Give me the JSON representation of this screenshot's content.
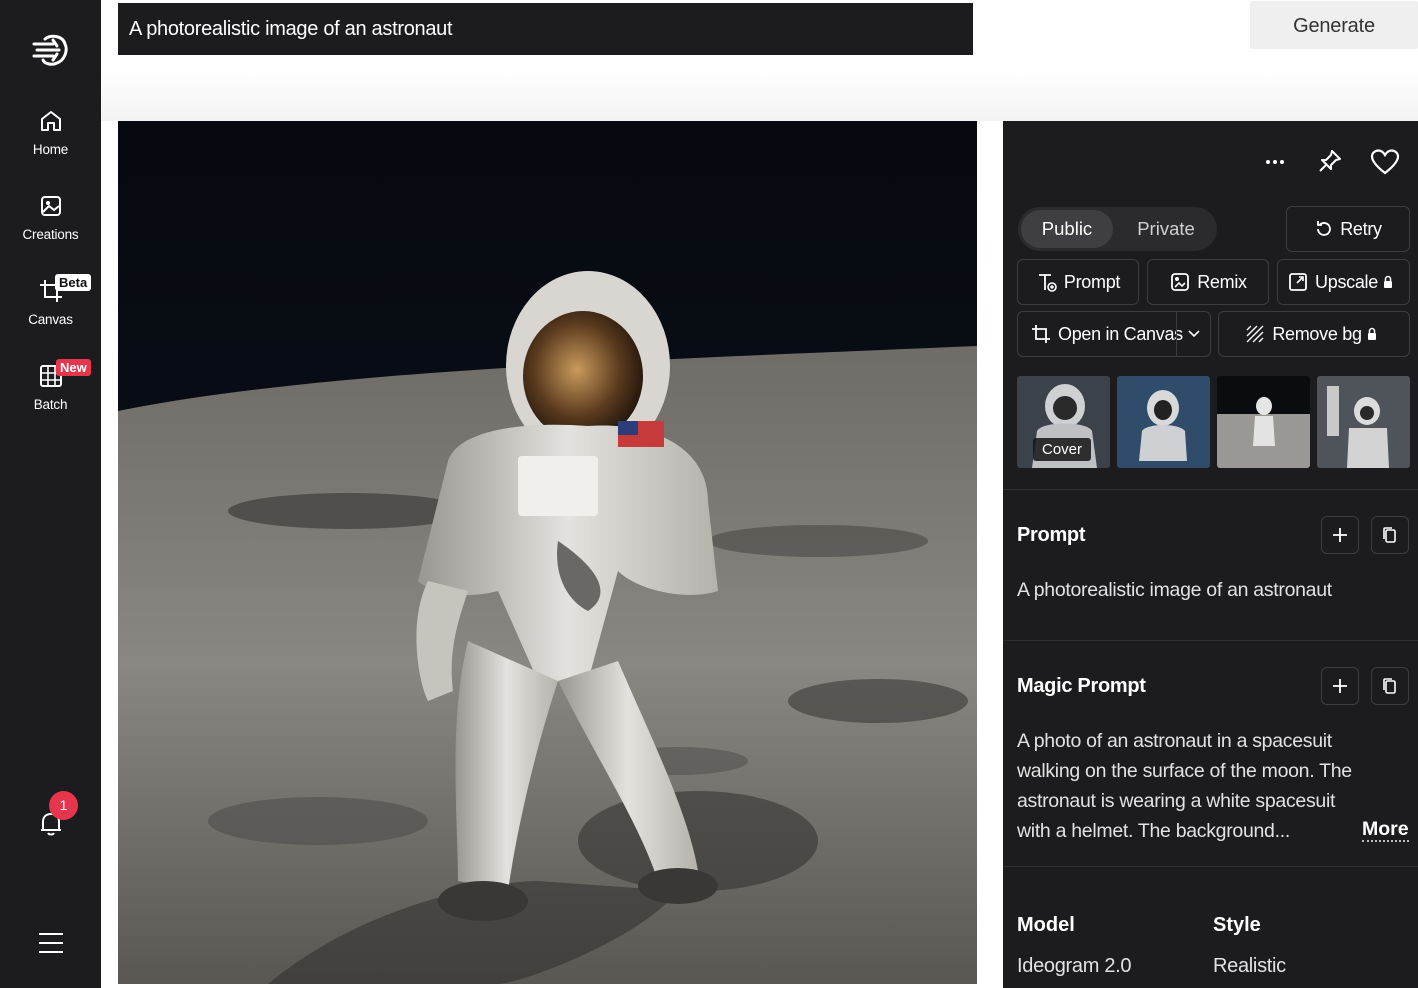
{
  "sidebar": {
    "items": [
      {
        "label": "Home",
        "icon": "home-icon"
      },
      {
        "label": "Creations",
        "icon": "image-icon"
      },
      {
        "label": "Canvas",
        "icon": "crop-icon",
        "badge": "Beta"
      },
      {
        "label": "Batch",
        "icon": "grid-image-icon",
        "badge": "New"
      }
    ],
    "notification_count": "1"
  },
  "prompt_input": {
    "value": "A photorealistic image of an astronaut"
  },
  "generate_label": "Generate",
  "panel": {
    "visibility": {
      "public": "Public",
      "private": "Private",
      "selected": "Public"
    },
    "retry_label": "Retry",
    "actions": {
      "prompt": "Prompt",
      "remix": "Remix",
      "upscale": "Upscale",
      "open_in_canvas": "Open in Canvas",
      "remove_bg": "Remove bg"
    },
    "cover_label": "Cover",
    "prompt_section": {
      "title": "Prompt",
      "text": "A photorealistic image of an astronaut"
    },
    "magic_prompt_section": {
      "title": "Magic Prompt",
      "text": "A photo of an astronaut in a spacesuit walking on the surface of the moon. The astronaut is wearing a white spacesuit with a helmet. The background...",
      "more_label": "More"
    },
    "meta": {
      "model_label": "Model",
      "model_value": "Ideogram 2.0",
      "style_label": "Style",
      "style_value": "Realistic"
    }
  },
  "colors": {
    "sidebar_bg": "#1c1b1d",
    "panel_bg": "#1c1b1d",
    "badge_red": "#e6364d"
  }
}
